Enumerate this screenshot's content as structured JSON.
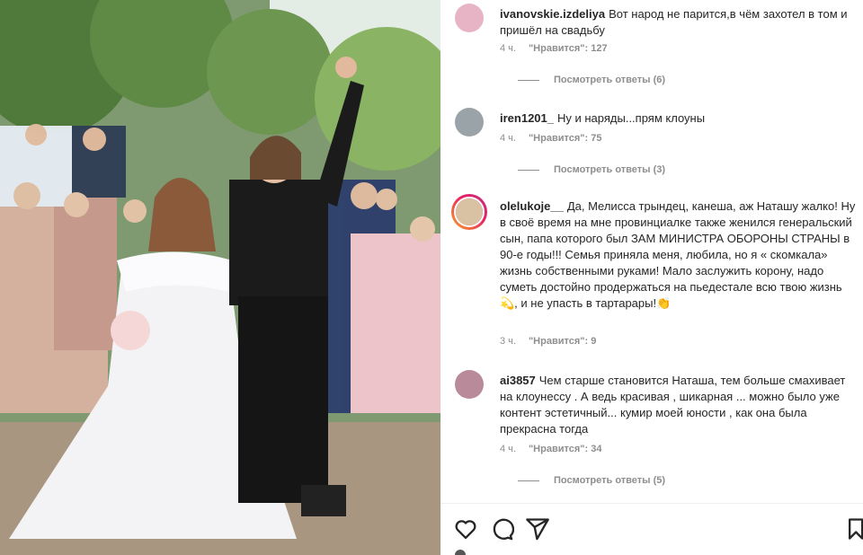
{
  "comments": [
    {
      "username": "ivanovskie.izdeliya",
      "text": "Вот народ не парится,в чём захотел в том и пришёл на свадьбу",
      "time": "4 ч.",
      "likes": "\"Нравится\": 127",
      "replies": "Посмотреть ответы (6)",
      "avatar_color": "#e7b4c6"
    },
    {
      "username": "iren1201_",
      "text": "Ну и наряды...прям клоуны",
      "time": "4 ч.",
      "likes": "\"Нравится\": 75",
      "replies": "Посмотреть ответы (3)",
      "avatar_color": "#9aa3a8"
    },
    {
      "username": "olelukoje__",
      "text": "Да, Мелисса трындец, канеша, аж Наташу жалко! Ну в своё время на мне провинциалке также женился генеральский сын, папа которого был ЗАМ МИНИСТРА ОБОРОНЫ СТРАНЫ в 90-е годы!!! Семья приняла меня, любила, но я « скомкала» жизнь собственными руками! Мало заслужить корону, надо суметь достойно продержаться на пьедестале всю твою жизнь💫, и не упасть в тартарары!👏",
      "time": "3 ч.",
      "likes": "\"Нравится\": 9",
      "avatar_color": "#d9c1a3"
    },
    {
      "username": "ai3857",
      "text": "Чем старше становится Наташа, тем больше смахивает на клоунессу . А ведь красивая , шикарная ... можно было уже контент эстетичный... кумир моей юности , как она была прекрасна тогда",
      "time": "4 ч.",
      "likes": "\"Нравится\": 34",
      "replies": "Посмотреть ответы (5)",
      "avatar_color": "#b98a9a"
    }
  ],
  "actions": [
    "heart-icon",
    "comment-icon",
    "share-icon",
    "bookmark-icon"
  ],
  "colors": {
    "text": "#262626",
    "muted": "#8e8e8e",
    "story_ring": "#e91e63"
  }
}
